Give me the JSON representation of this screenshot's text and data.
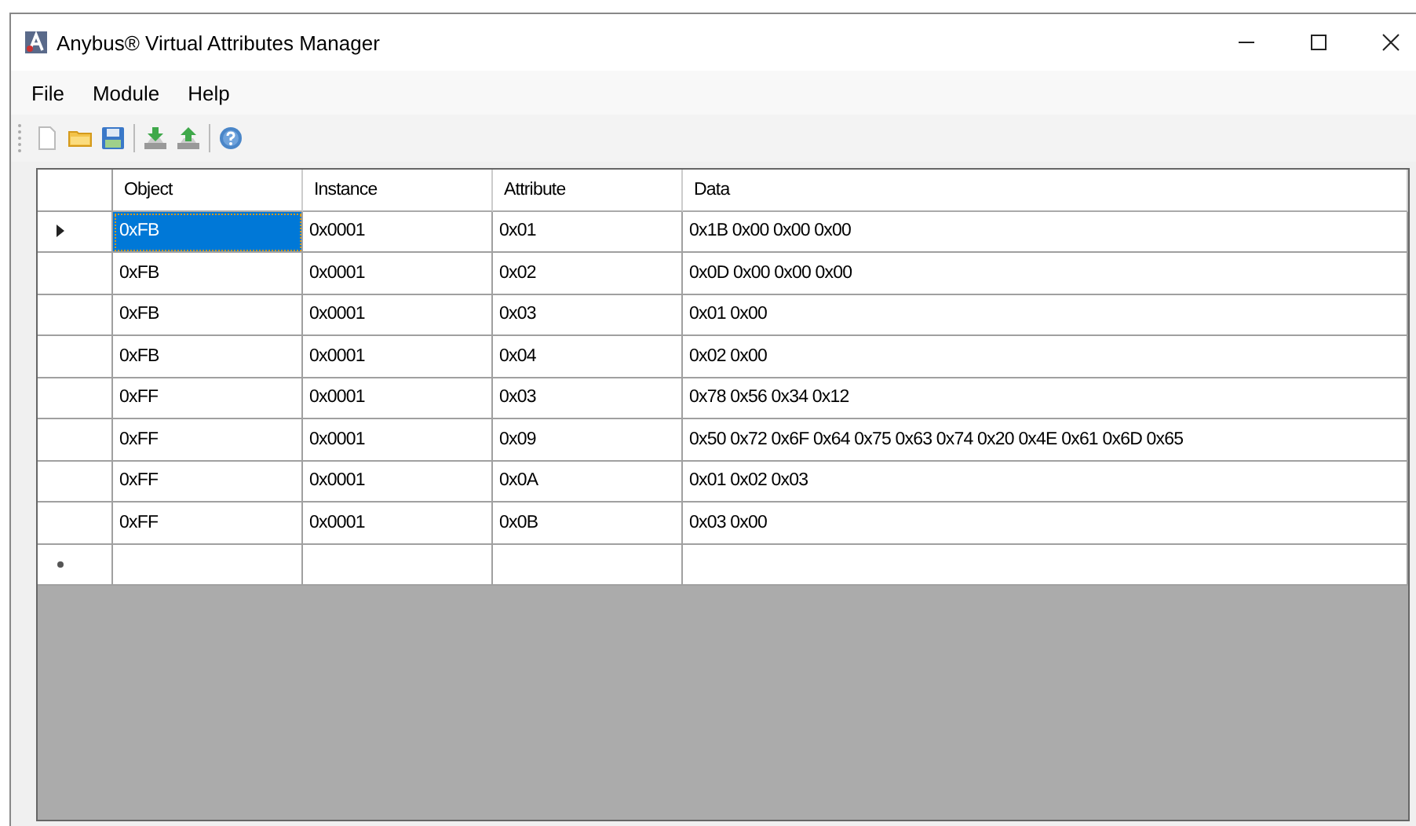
{
  "window": {
    "title": "Anybus® Virtual Attributes Manager"
  },
  "menu": [
    "File",
    "Module",
    "Help"
  ],
  "toolbar": [
    {
      "kind": "new"
    },
    {
      "kind": "open"
    },
    {
      "kind": "save"
    },
    {
      "kind": "sep"
    },
    {
      "kind": "download"
    },
    {
      "kind": "upload"
    },
    {
      "kind": "sep"
    },
    {
      "kind": "help"
    }
  ],
  "table": {
    "columns": [
      "Object",
      "Instance",
      "Attribute",
      "Data"
    ],
    "rows": [
      {
        "selected": true,
        "cells": [
          "0xFB",
          "0x0001",
          "0x01",
          "0x1B 0x00 0x00 0x00"
        ]
      },
      {
        "selected": false,
        "cells": [
          "0xFB",
          "0x0001",
          "0x02",
          "0x0D 0x00 0x00 0x00"
        ]
      },
      {
        "selected": false,
        "cells": [
          "0xFB",
          "0x0001",
          "0x03",
          "0x01 0x00"
        ]
      },
      {
        "selected": false,
        "cells": [
          "0xFB",
          "0x0001",
          "0x04",
          "0x02 0x00"
        ]
      },
      {
        "selected": false,
        "cells": [
          "0xFF",
          "0x0001",
          "0x03",
          "0x78 0x56 0x34 0x12"
        ]
      },
      {
        "selected": false,
        "cells": [
          "0xFF",
          "0x0001",
          "0x09",
          "0x50 0x72 0x6F 0x64 0x75 0x63 0x74 0x20 0x4E 0x61 0x6D 0x65"
        ]
      },
      {
        "selected": false,
        "cells": [
          "0xFF",
          "0x0001",
          "0x0A",
          "0x01 0x02 0x03"
        ]
      },
      {
        "selected": false,
        "cells": [
          "0xFF",
          "0x0001",
          "0x0B",
          "0x03 0x00"
        ]
      }
    ],
    "new_row": true
  }
}
